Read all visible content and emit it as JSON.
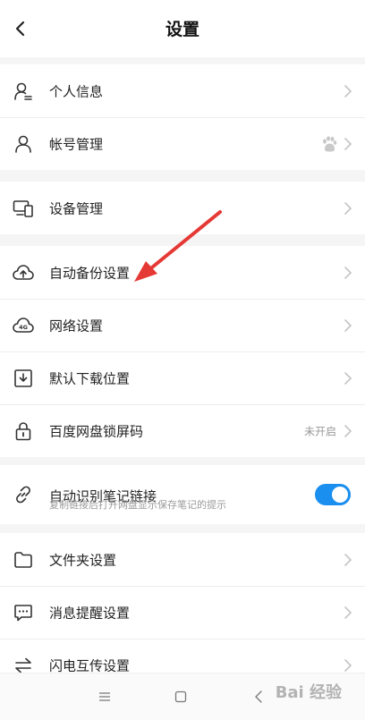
{
  "header": {
    "title": "设置"
  },
  "groups": {
    "account": [
      {
        "label": "个人信息"
      },
      {
        "label": "帐号管理"
      }
    ],
    "device": [
      {
        "label": "设备管理"
      }
    ],
    "general": [
      {
        "label": "自动备份设置"
      },
      {
        "label": "网络设置"
      },
      {
        "label": "默认下载位置"
      },
      {
        "label": "百度网盘锁屏码",
        "value": "未开启"
      }
    ],
    "note": {
      "label": "自动识别笔记链接",
      "sublabel": "复制链接后打开网盘显示保存笔记的提示",
      "enabled": true
    },
    "misc": [
      {
        "label": "文件夹设置"
      },
      {
        "label": "消息提醒设置"
      },
      {
        "label": "闪电互传设置"
      }
    ]
  },
  "watermark": "Bai 经验",
  "colors": {
    "accent": "#1b8ff0",
    "arrow": "#e53935"
  }
}
